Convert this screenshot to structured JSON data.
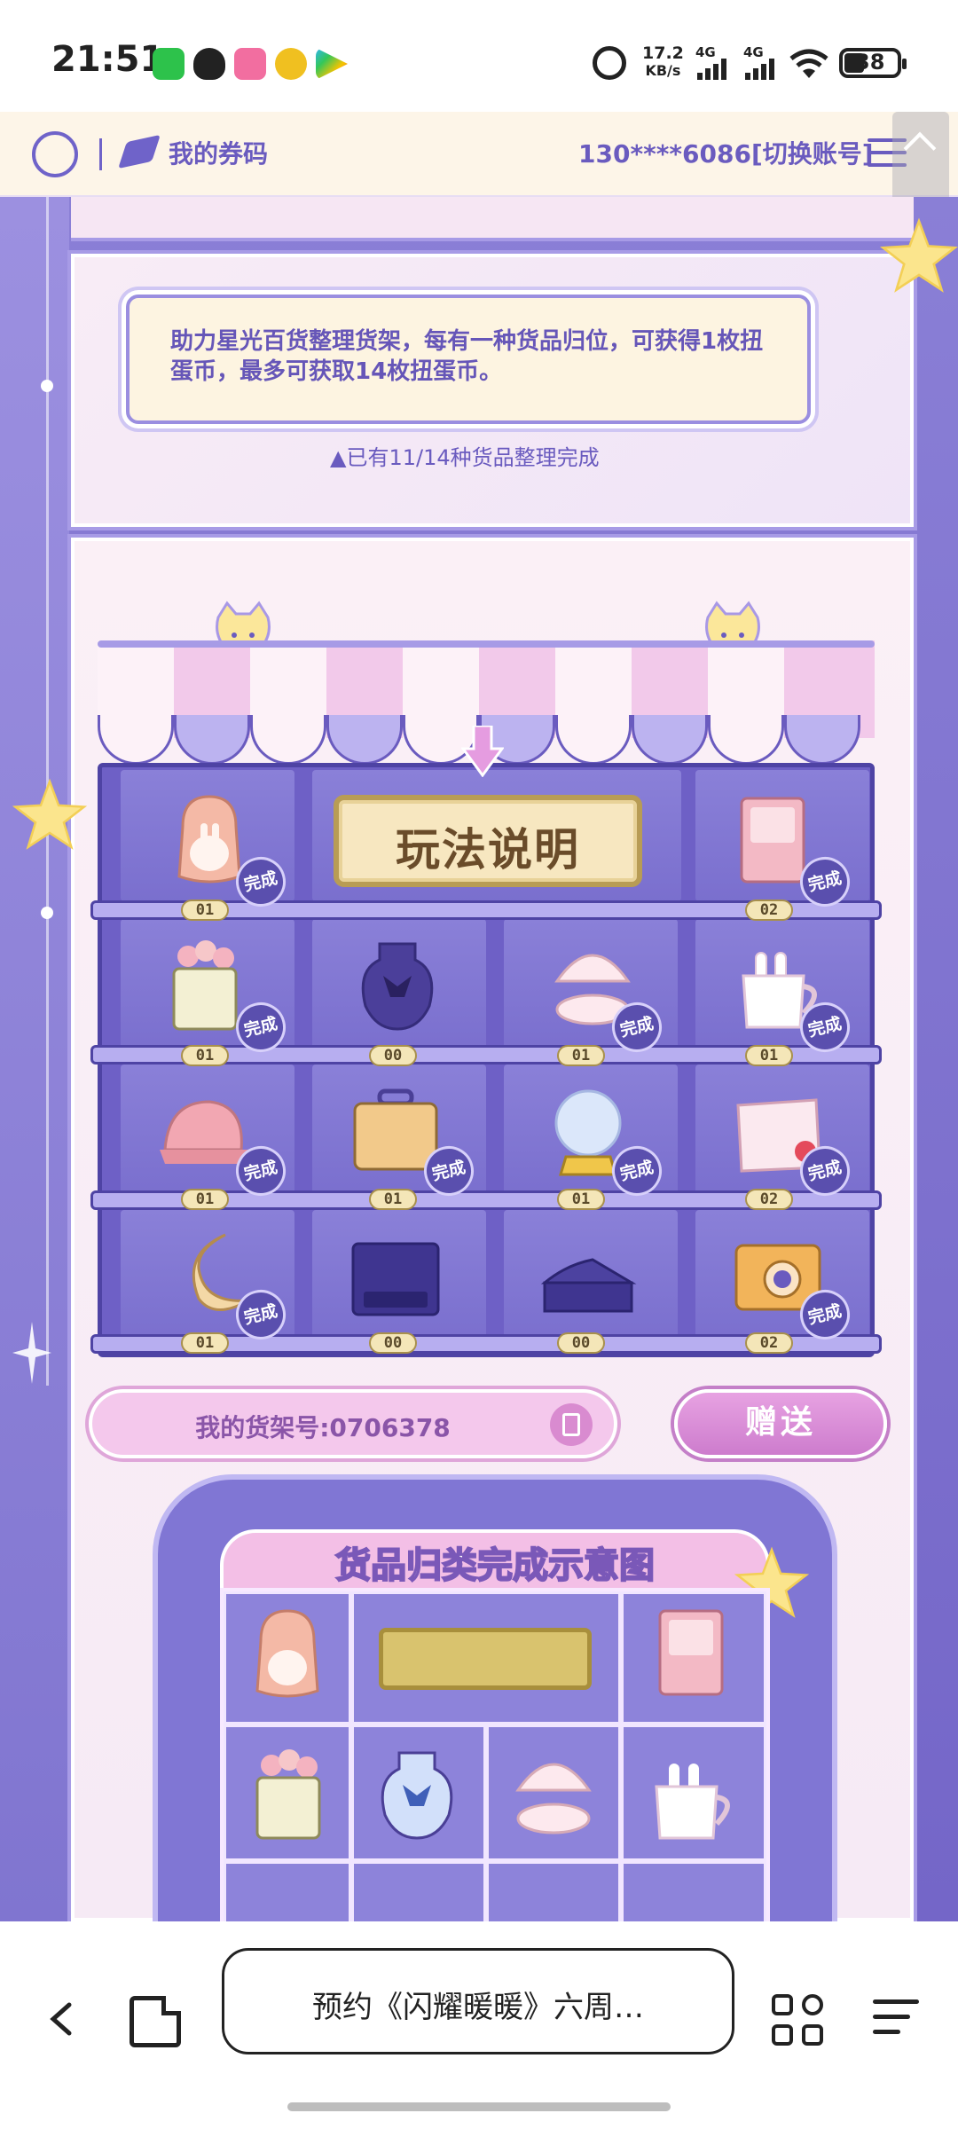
{
  "status_bar": {
    "time": "21:51",
    "network_speed_value": "17.2",
    "network_speed_unit": "KB/s",
    "net1": "4G",
    "net2": "4G",
    "battery": "38",
    "icons": [
      "wechat-icon",
      "qq-icon",
      "bilibili-icon",
      "app-icon",
      "play-store-icon",
      "alarm-icon",
      "signal-icon",
      "wifi-icon",
      "battery-icon"
    ]
  },
  "header": {
    "my_codes": "我的券码",
    "account": "130****6086[切换账号]"
  },
  "event": {
    "description": "助力星光百货整理货架，每有一种货品归位，可获得1枚扭蛋币，最多可获取14枚扭蛋币。",
    "progress_note": "▲已有11/14种货品整理完成",
    "rules_label": "玩法说明",
    "done_label": "完成",
    "shelf_rows": [
      [
        {
          "item": "rabbit-backpack",
          "count": "01",
          "done": true
        },
        {
          "item": "rules-sign",
          "count": "",
          "done": false
        },
        {
          "item": "photo-album",
          "count": "02",
          "done": true
        }
      ],
      [
        {
          "item": "flower-basket",
          "count": "01",
          "done": true
        },
        {
          "item": "perfume-bottle",
          "count": "00",
          "done": false
        },
        {
          "item": "shell-ring-box",
          "count": "01",
          "done": true
        },
        {
          "item": "bunny-mug",
          "count": "01",
          "done": true
        }
      ],
      [
        {
          "item": "pink-cap",
          "count": "01",
          "done": true
        },
        {
          "item": "suitcase",
          "count": "01",
          "done": true
        },
        {
          "item": "crystal-ball",
          "count": "01",
          "done": true
        },
        {
          "item": "milk-carton",
          "count": "02",
          "done": true
        }
      ],
      [
        {
          "item": "moon-pillow",
          "count": "01",
          "done": true
        },
        {
          "item": "nikki-box",
          "count": "00",
          "done": false
        },
        {
          "item": "cake",
          "count": "00",
          "done": false
        },
        {
          "item": "camera",
          "count": "02",
          "done": true
        }
      ]
    ],
    "shelf_number": "我的货架号:0706378",
    "send_label": "赠送",
    "diagram_title": "货品归类完成示意图",
    "colors": {
      "accent": "#6a5bbf",
      "panel": "#fbf2f8",
      "shelf": "#6e60c6",
      "pink_button": "#cd7ccd"
    }
  },
  "browser": {
    "address": "预约《闪耀暖暖》六周…"
  }
}
